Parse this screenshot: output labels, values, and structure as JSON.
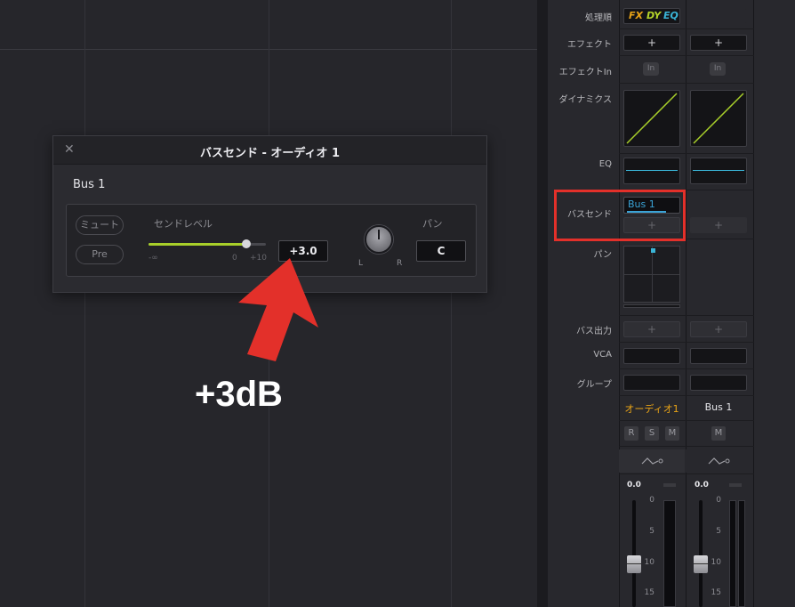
{
  "dialog": {
    "title": "バスセンド - オーディオ 1",
    "bus_name": "Bus 1",
    "mute_label": "ミュート",
    "pre_label": "Pre",
    "send_level_label": "センドレベル",
    "send_level_value": "+3.0",
    "slider_ticks": [
      "-∞",
      "0",
      "+10"
    ],
    "slider_position": 0.83,
    "pan_label": "パン",
    "pan_value": "C",
    "pan_l": "L",
    "pan_r": "R"
  },
  "annotation": {
    "label": "+3dB",
    "arrow_color": "#e3302a"
  },
  "mixer": {
    "rows": {
      "order": "処理順",
      "effects": "エフェクト",
      "effects_in": "エフェクトIn",
      "dynamics": "ダイナミクス",
      "eq": "EQ",
      "bus_send": "バスセンド",
      "pan": "パン",
      "bus_out": "バス出力",
      "vca": "VCA",
      "group": "グループ"
    },
    "order_tags": {
      "fx": "FX",
      "dy": "DY",
      "eq": "EQ"
    },
    "plus_label": "+",
    "in_label": "In",
    "bus_send_value": "Bus 1",
    "tracks": [
      {
        "name": "オーディオ1",
        "color": "#e8a317",
        "buttons": [
          "R",
          "S",
          "M"
        ],
        "fader_value": "0.0"
      },
      {
        "name": "Bus 1",
        "color": "#e6e6ea",
        "buttons": [
          "M"
        ],
        "fader_value": "0.0"
      }
    ],
    "fader_scale": [
      "0",
      "5",
      "10",
      "15"
    ]
  }
}
